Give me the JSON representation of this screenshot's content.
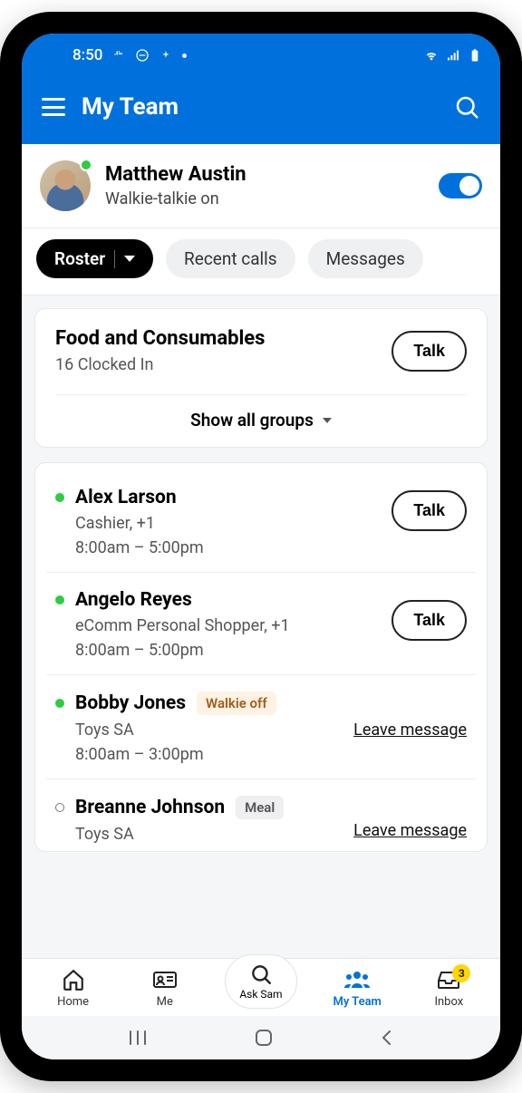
{
  "statusbar": {
    "time": "8:50"
  },
  "header": {
    "title": "My Team"
  },
  "user": {
    "name": "Matthew Austin",
    "status": "Walkie-talkie on",
    "toggle_on": true
  },
  "tabs": {
    "roster": "Roster",
    "recent_calls": "Recent calls",
    "messages": "Messages"
  },
  "group": {
    "name": "Food and Consumables",
    "sub": "16 Clocked In",
    "talk": "Talk",
    "show_all": "Show all groups"
  },
  "btn": {
    "talk": "Talk",
    "leave_message": "Leave message"
  },
  "people": [
    {
      "name": "Alex Larson",
      "role": "Cashier, +1",
      "time": "8:00am – 5:00pm",
      "presence": "online",
      "action": "talk",
      "badge": ""
    },
    {
      "name": "Angelo Reyes",
      "role": "eComm Personal Shopper, +1",
      "time": "8:00am – 5:00pm",
      "presence": "online",
      "action": "talk",
      "badge": ""
    },
    {
      "name": "Bobby Jones",
      "role": "Toys SA",
      "time": "8:00am – 3:00pm",
      "presence": "online",
      "action": "message",
      "badge": "Walkie off",
      "badge_style": "warn"
    },
    {
      "name": "Breanne Johnson",
      "role": "Toys SA",
      "time": "",
      "presence": "offline",
      "action": "message",
      "badge": "Meal",
      "badge_style": "grey"
    }
  ],
  "nav": {
    "home": "Home",
    "me": "Me",
    "ask_sam": "Ask Sam",
    "my_team": "My Team",
    "inbox": "Inbox",
    "inbox_badge": "3"
  }
}
